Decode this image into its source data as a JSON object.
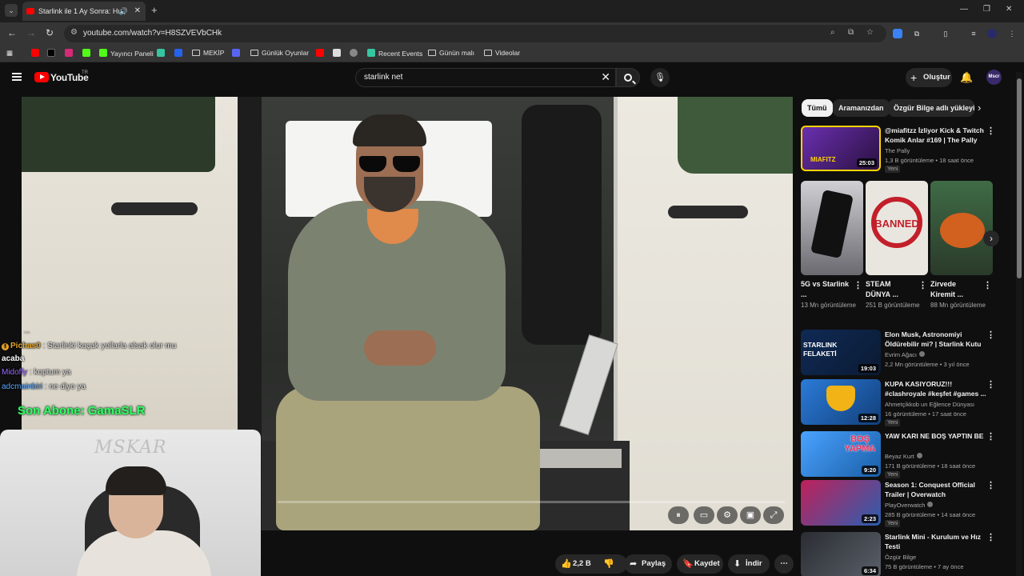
{
  "browser": {
    "tab_title": "Starlink ile 1 Ay Sonra: Hız,",
    "url": "youtube.com/watch?v=H8SZVEVbCHk",
    "bookmarks": [
      {
        "label": "Yayıncı Paneli"
      },
      {
        "label": "MEKİP"
      },
      {
        "label": "Günlük Oyunlar"
      },
      {
        "label": "Recent Events"
      },
      {
        "label": "Günün malı"
      },
      {
        "label": "Videolar"
      }
    ]
  },
  "header": {
    "logo_text": "YouTube",
    "country": "TR",
    "search_value": "starlink net",
    "create_label": "Oluştur",
    "avatar_text": "Mscr"
  },
  "player": {
    "chat": [
      {
        "user": "Pichas0",
        "message": ": Starlinki kaçak yollarla alsak olur mu"
      },
      {
        "user": "acaba",
        "message": ""
      },
      {
        "user": "Midoffy",
        "message": ": koptum ya"
      },
      {
        "user": "adcmainbiri",
        "message": ": ne diyo ya"
      }
    ],
    "chat_faded": "...",
    "sub_alert": "Son Abone: GamaSLR",
    "webcam_watermark": "MSKAR"
  },
  "actions": {
    "likes": "2,2 B",
    "share": "Paylaş",
    "save": "Kaydet",
    "download": "İndir"
  },
  "chips": [
    "Tümü",
    "Aramanızdan",
    "Özgür Bilge adlı yükleyici"
  ],
  "videos_top": [
    {
      "title": "@miafitzz İzliyor Kick & Twitch Komik Anlar #169 | The Pally",
      "channel": "The Pally",
      "meta": "1,3 B görüntüleme • 18 saat önce",
      "badge": "Yeni",
      "duration": "25:03",
      "verified": false
    }
  ],
  "shorts": [
    {
      "title": "5G vs Starlink ...",
      "views": "13 Mn görüntüleme"
    },
    {
      "title": "STEAM DÜNYA ...",
      "views": "251 B görüntüleme"
    },
    {
      "title": "Zirvede Kiremit ...",
      "views": "88 Mn görüntüleme"
    }
  ],
  "videos": [
    {
      "title": "Elon Musk, Astronomiyi Öldürebilir mi? | Starlink Kutu ...",
      "channel": "Evrim Ağacı",
      "meta": "2,2 Mn görüntüleme • 3 yıl önce",
      "badge": "",
      "duration": "19:03",
      "verified": true
    },
    {
      "title": "KUPA KASIYORUZ!!! #clashroyale #keşfet #games ...",
      "channel": "Ahmetçikkob un Eğlence Dünyası",
      "meta": "16 görüntüleme • 17 saat önce",
      "badge": "Yeni",
      "duration": "12:28",
      "verified": false
    },
    {
      "title": "YAW KARI NE BOŞ YAPTIN BE",
      "channel": "Beyaz Kurt",
      "meta": "171 B görüntüleme • 18 saat önce",
      "badge": "Yeni",
      "duration": "9:20",
      "verified": true
    },
    {
      "title": "Season 1: Conquest Official Trailer | Overwatch",
      "channel": "PlayOverwatch",
      "meta": "285 B görüntüleme • 14 saat önce",
      "badge": "Yeni",
      "duration": "2:23",
      "verified": true
    },
    {
      "title": "Starlink Mini - Kurulum ve Hız Testi",
      "channel": "Özgür Bilge",
      "meta": "75 B görüntüleme • 7 ay önce",
      "badge": "",
      "duration": "6:34",
      "verified": false
    }
  ],
  "thumb_texts": {
    "banned": "BANNED",
    "bos_yapma": "BOŞ YAPMA",
    "starlink_felaketi": "STARLINK FELAKETİ",
    "miafitz": "MIAFITZ"
  },
  "colors": {
    "yt_red": "#ff0000",
    "sub_alert_green": "#33ff66",
    "chat_user_1": "#e7a72c",
    "chat_user_2": "#9b6cff",
    "chat_user_3": "#5aa8ff"
  }
}
